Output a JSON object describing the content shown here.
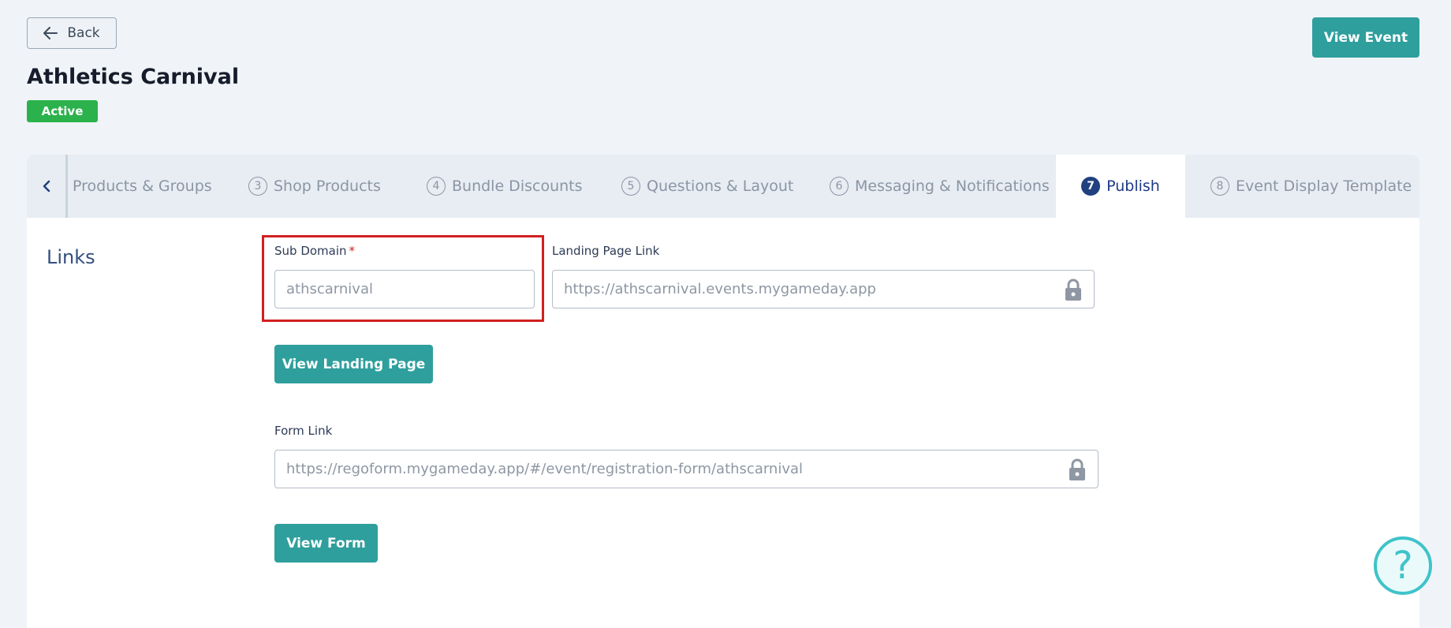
{
  "header": {
    "back_label": "Back",
    "view_event_label": "View Event",
    "title": "Athletics Carnival",
    "status": "Active"
  },
  "tabs": [
    {
      "number": "",
      "label": "Products & Groups",
      "active": false
    },
    {
      "number": "3",
      "label": "Shop Products",
      "active": false
    },
    {
      "number": "4",
      "label": "Bundle Discounts",
      "active": false
    },
    {
      "number": "5",
      "label": "Questions & Layout",
      "active": false
    },
    {
      "number": "6",
      "label": "Messaging & Notifications",
      "active": false
    },
    {
      "number": "7",
      "label": "Publish",
      "active": true
    },
    {
      "number": "8",
      "label": "Event Display Template",
      "active": false
    }
  ],
  "links": {
    "section_title": "Links",
    "sub_domain": {
      "label": "Sub Domain",
      "required_mark": "*",
      "value": "athscarnival"
    },
    "landing_page": {
      "label": "Landing Page Link",
      "value": "https://athscarnival.events.mygameday.app",
      "button_label": "View Landing Page"
    },
    "form": {
      "label": "Form Link",
      "value": "https://regoform.mygameday.app/#/event/registration-form/athscarnival",
      "button_label": "View Form"
    }
  },
  "help": {
    "icon": "question-mark-icon",
    "label": "?"
  },
  "colors": {
    "accent_teal": "#2e9f9c",
    "active_tab": "#21407f",
    "status_green": "#2bb24c",
    "highlight_red": "#d21f1f"
  }
}
